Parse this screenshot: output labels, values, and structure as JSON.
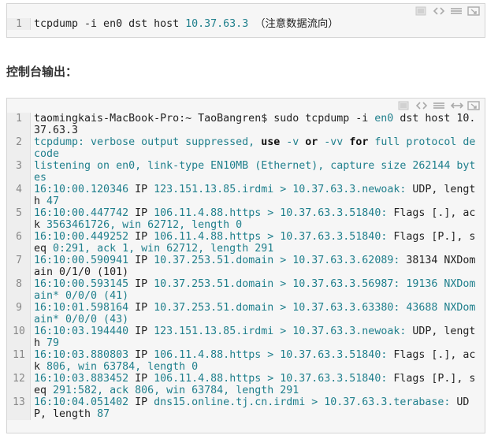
{
  "snippet1": {
    "lines": [
      {
        "num": "1",
        "segments": [
          {
            "t": "tcpdump -i en0 dst host ",
            "c": "k"
          },
          {
            "t": "10.37.63.3",
            "c": ""
          },
          {
            "t": " （注意数据流向）",
            "c": "k"
          }
        ]
      }
    ]
  },
  "heading": "控制台输出：",
  "snippet2": {
    "lines": [
      {
        "num": "1",
        "segments": [
          {
            "t": "taomingkais-MacBook-Pro:~ TaoBangren$ sudo tcpdump -i ",
            "c": "k"
          },
          {
            "t": "en0",
            "c": ""
          },
          {
            "t": " dst host 10.37.63.3",
            "c": "k"
          }
        ]
      },
      {
        "num": "2",
        "segments": [
          {
            "t": "tcpdump: verbose output suppressed, ",
            "c": ""
          },
          {
            "t": "use",
            "c": "b"
          },
          {
            "t": " -v ",
            "c": ""
          },
          {
            "t": "or",
            "c": "b"
          },
          {
            "t": " -vv ",
            "c": ""
          },
          {
            "t": "for",
            "c": "b"
          },
          {
            "t": " full protocol decode",
            "c": ""
          }
        ]
      },
      {
        "num": "3",
        "segments": [
          {
            "t": "listening on en0, link-type EN10MB (Ethernet), capture size 262144 bytes",
            "c": ""
          }
        ]
      },
      {
        "num": "4",
        "segments": [
          {
            "t": "16:10:00.120346 ",
            "c": ""
          },
          {
            "t": "IP ",
            "c": "k"
          },
          {
            "t": "123.151.13.85.irdmi > 10.37.63.3.newoak: ",
            "c": ""
          },
          {
            "t": "UDP, length ",
            "c": "k"
          },
          {
            "t": "47",
            "c": ""
          }
        ]
      },
      {
        "num": "5",
        "segments": [
          {
            "t": "16:10:00.447742 ",
            "c": ""
          },
          {
            "t": "IP ",
            "c": "k"
          },
          {
            "t": "106.11.4.88.https > 10.37.63.3.51840: ",
            "c": ""
          },
          {
            "t": "Flags [.], ack ",
            "c": "k"
          },
          {
            "t": "3563461726, win 62712, length 0",
            "c": ""
          }
        ]
      },
      {
        "num": "6",
        "segments": [
          {
            "t": "16:10:00.449252 ",
            "c": ""
          },
          {
            "t": "IP ",
            "c": "k"
          },
          {
            "t": "106.11.4.88.https > 10.37.63.3.51840: ",
            "c": ""
          },
          {
            "t": "Flags [P.], seq ",
            "c": "k"
          },
          {
            "t": "0:291, ack 1, win 62712, length 291",
            "c": ""
          }
        ]
      },
      {
        "num": "7",
        "segments": [
          {
            "t": "16:10:00.590941 ",
            "c": ""
          },
          {
            "t": "IP ",
            "c": "k"
          },
          {
            "t": "10.37.253.51.domain > 10.37.63.3.62089: ",
            "c": ""
          },
          {
            "t": "38134 NXDomain 0/1/0 (101)",
            "c": "k"
          }
        ]
      },
      {
        "num": "8",
        "segments": [
          {
            "t": "16:10:00.593145 ",
            "c": ""
          },
          {
            "t": "IP ",
            "c": "k"
          },
          {
            "t": "10.37.253.51.domain > 10.37.63.3.56987: 19136 NXDomain* 0/0/0 (41)",
            "c": ""
          }
        ]
      },
      {
        "num": "9",
        "segments": [
          {
            "t": "16:10:01.598164 ",
            "c": ""
          },
          {
            "t": "IP ",
            "c": "k"
          },
          {
            "t": "10.37.253.51.domain > 10.37.63.3.63380: 43688 NXDomain* 0/0/0 (43)",
            "c": ""
          }
        ]
      },
      {
        "num": "10",
        "segments": [
          {
            "t": "16:10:03.194440 ",
            "c": ""
          },
          {
            "t": "IP ",
            "c": "k"
          },
          {
            "t": "123.151.13.85.irdmi > 10.37.63.3.newoak: ",
            "c": ""
          },
          {
            "t": "UDP, length ",
            "c": "k"
          },
          {
            "t": "79",
            "c": ""
          }
        ]
      },
      {
        "num": "11",
        "segments": [
          {
            "t": "16:10:03.880803 ",
            "c": ""
          },
          {
            "t": "IP ",
            "c": "k"
          },
          {
            "t": "106.11.4.88.https > 10.37.63.3.51840: ",
            "c": ""
          },
          {
            "t": "Flags [.], ack ",
            "c": "k"
          },
          {
            "t": "806, win 63784, length 0",
            "c": ""
          }
        ]
      },
      {
        "num": "12",
        "segments": [
          {
            "t": "16:10:03.883452 ",
            "c": ""
          },
          {
            "t": "IP ",
            "c": "k"
          },
          {
            "t": "106.11.4.88.https > 10.37.63.3.51840: ",
            "c": ""
          },
          {
            "t": "Flags [P.], seq ",
            "c": "k"
          },
          {
            "t": "291:582, ack 806, win 63784, length 291",
            "c": ""
          }
        ]
      },
      {
        "num": "13",
        "segments": [
          {
            "t": "16:10:04.051402 ",
            "c": ""
          },
          {
            "t": "IP ",
            "c": "k"
          },
          {
            "t": "dns15.online.tj.cn.irdmi > 10.37.63.3.terabase: ",
            "c": ""
          },
          {
            "t": "UDP, length ",
            "c": "k"
          },
          {
            "t": "87",
            "c": ""
          }
        ]
      }
    ]
  },
  "icons": [
    "view-source-icon",
    "code-icon",
    "wrap-icon",
    "expand-icon",
    "popup-icon"
  ]
}
